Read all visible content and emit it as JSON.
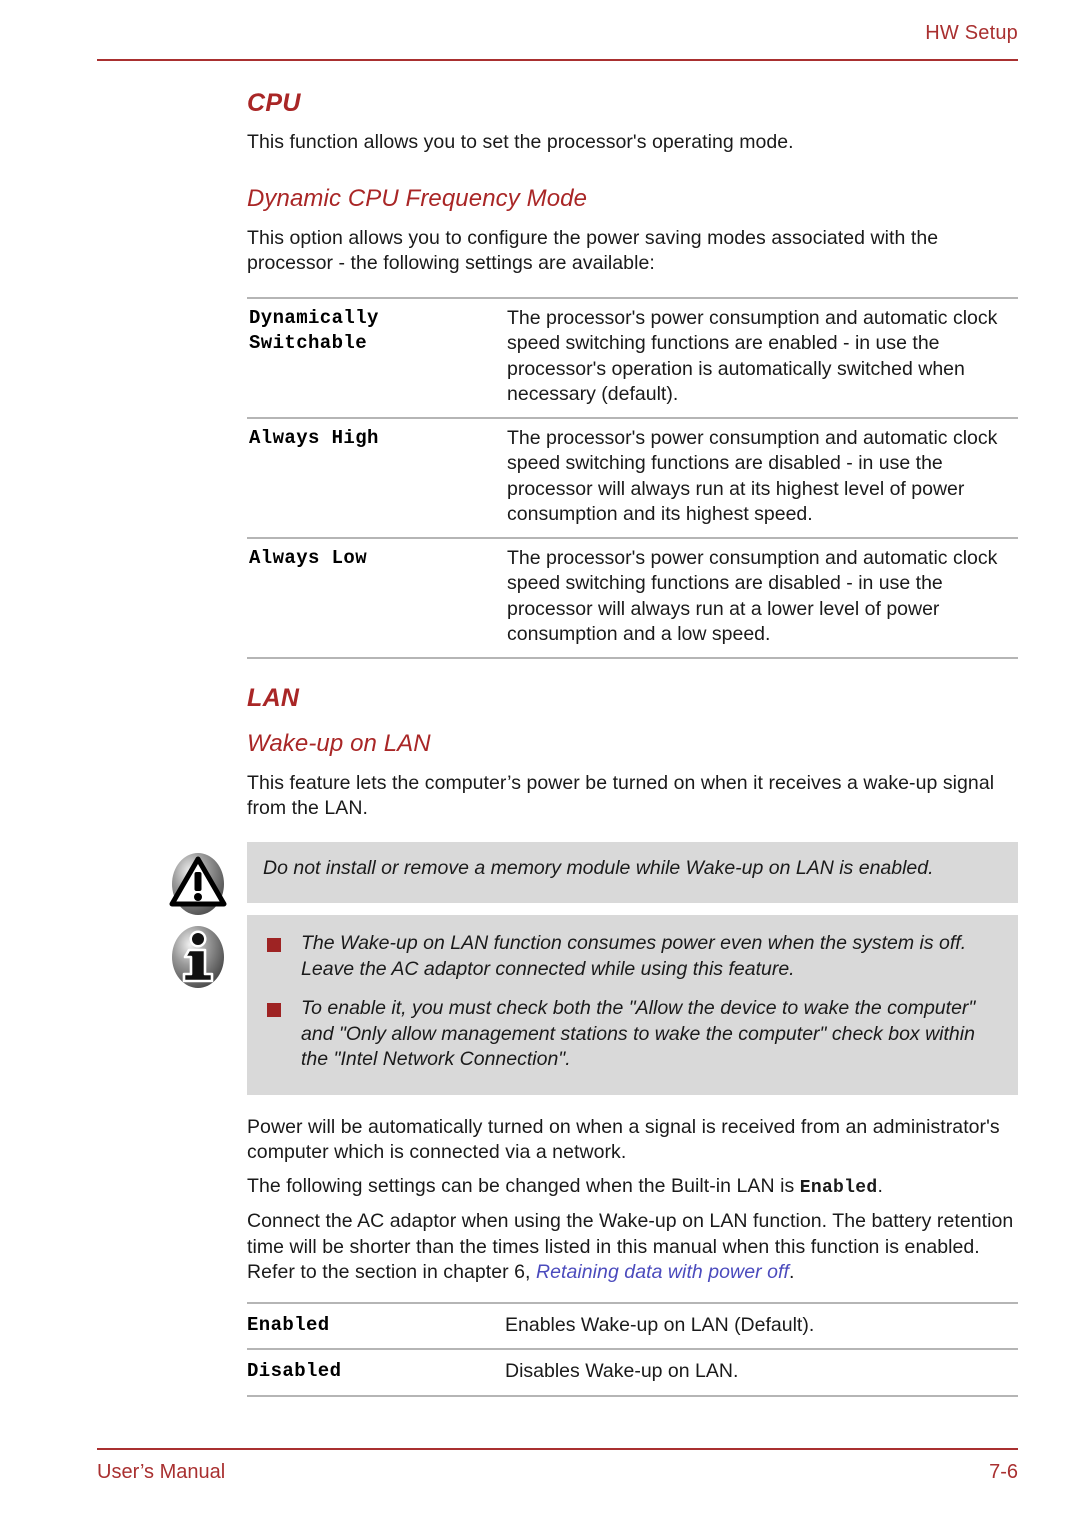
{
  "header": {
    "title": "HW Setup"
  },
  "sections": {
    "cpu": {
      "heading": "CPU",
      "intro": "This function allows you to set the processor's operating mode.",
      "sub_heading": "Dynamic CPU Frequency Mode",
      "sub_intro": "This option allows you to configure the power saving modes associated with the processor - the following settings are available:",
      "options": [
        {
          "term": "Dynamically Switchable",
          "description": "The processor's power consumption and automatic clock speed switching functions are enabled - in use the processor's operation is automatically switched when necessary (default)."
        },
        {
          "term": "Always High",
          "description": "The processor's power consumption and automatic clock speed switching functions are disabled - in use the processor will always run at its highest level of power consumption and its highest speed."
        },
        {
          "term": "Always Low",
          "description": "The processor's power consumption and automatic clock speed switching functions are disabled - in use the processor will always run at a lower level of power consumption and a low speed."
        }
      ]
    },
    "lan": {
      "heading": "LAN",
      "sub_heading": "Wake-up on LAN",
      "intro": "This feature lets the computer’s power be turned on when it receives a wake-up signal from the LAN.",
      "warning_callout": {
        "icon": "warning-triangle-icon",
        "text": "Do not install or remove a memory module while Wake-up on LAN is enabled."
      },
      "info_callout": {
        "icon": "info-circle-icon",
        "bullets": [
          "The Wake-up on LAN function consumes power even when the system is off. Leave the AC adaptor connected while using this feature.",
          "To enable it, you must check both the \"Allow the device to wake the computer\" and \"Only allow management stations to wake the computer\" check box within the \"Intel Network Connection\"."
        ]
      },
      "paragraph_1": "Power will be automatically turned on when a signal is received from an administrator's computer which is connected via a network.",
      "paragraph_2_prefix": "The following settings can be changed when the Built-in LAN is ",
      "paragraph_2_mono": "Enabled",
      "paragraph_2_suffix": ".",
      "paragraph_3_prefix": "Connect the AC adaptor when using the Wake-up on LAN function. The battery retention time will be shorter than the times listed in this manual when this function is enabled. Refer to the section in chapter 6, ",
      "paragraph_3_link": "Retaining data with power off",
      "paragraph_3_suffix": ".",
      "options": [
        {
          "term": "Enabled",
          "description": "Enables Wake-up on LAN (Default)."
        },
        {
          "term": "Disabled",
          "description": "Disables Wake-up on LAN."
        }
      ]
    }
  },
  "footer": {
    "left": "User’s Manual",
    "right": "7-6"
  },
  "colors": {
    "accent_red": "#a92626",
    "header_red": "#a93030",
    "bullet_red": "#9e2323",
    "link_blue": "#4b4bbd",
    "callout_bg": "#d9d9d9",
    "rule_gray": "#b5b5b5"
  }
}
